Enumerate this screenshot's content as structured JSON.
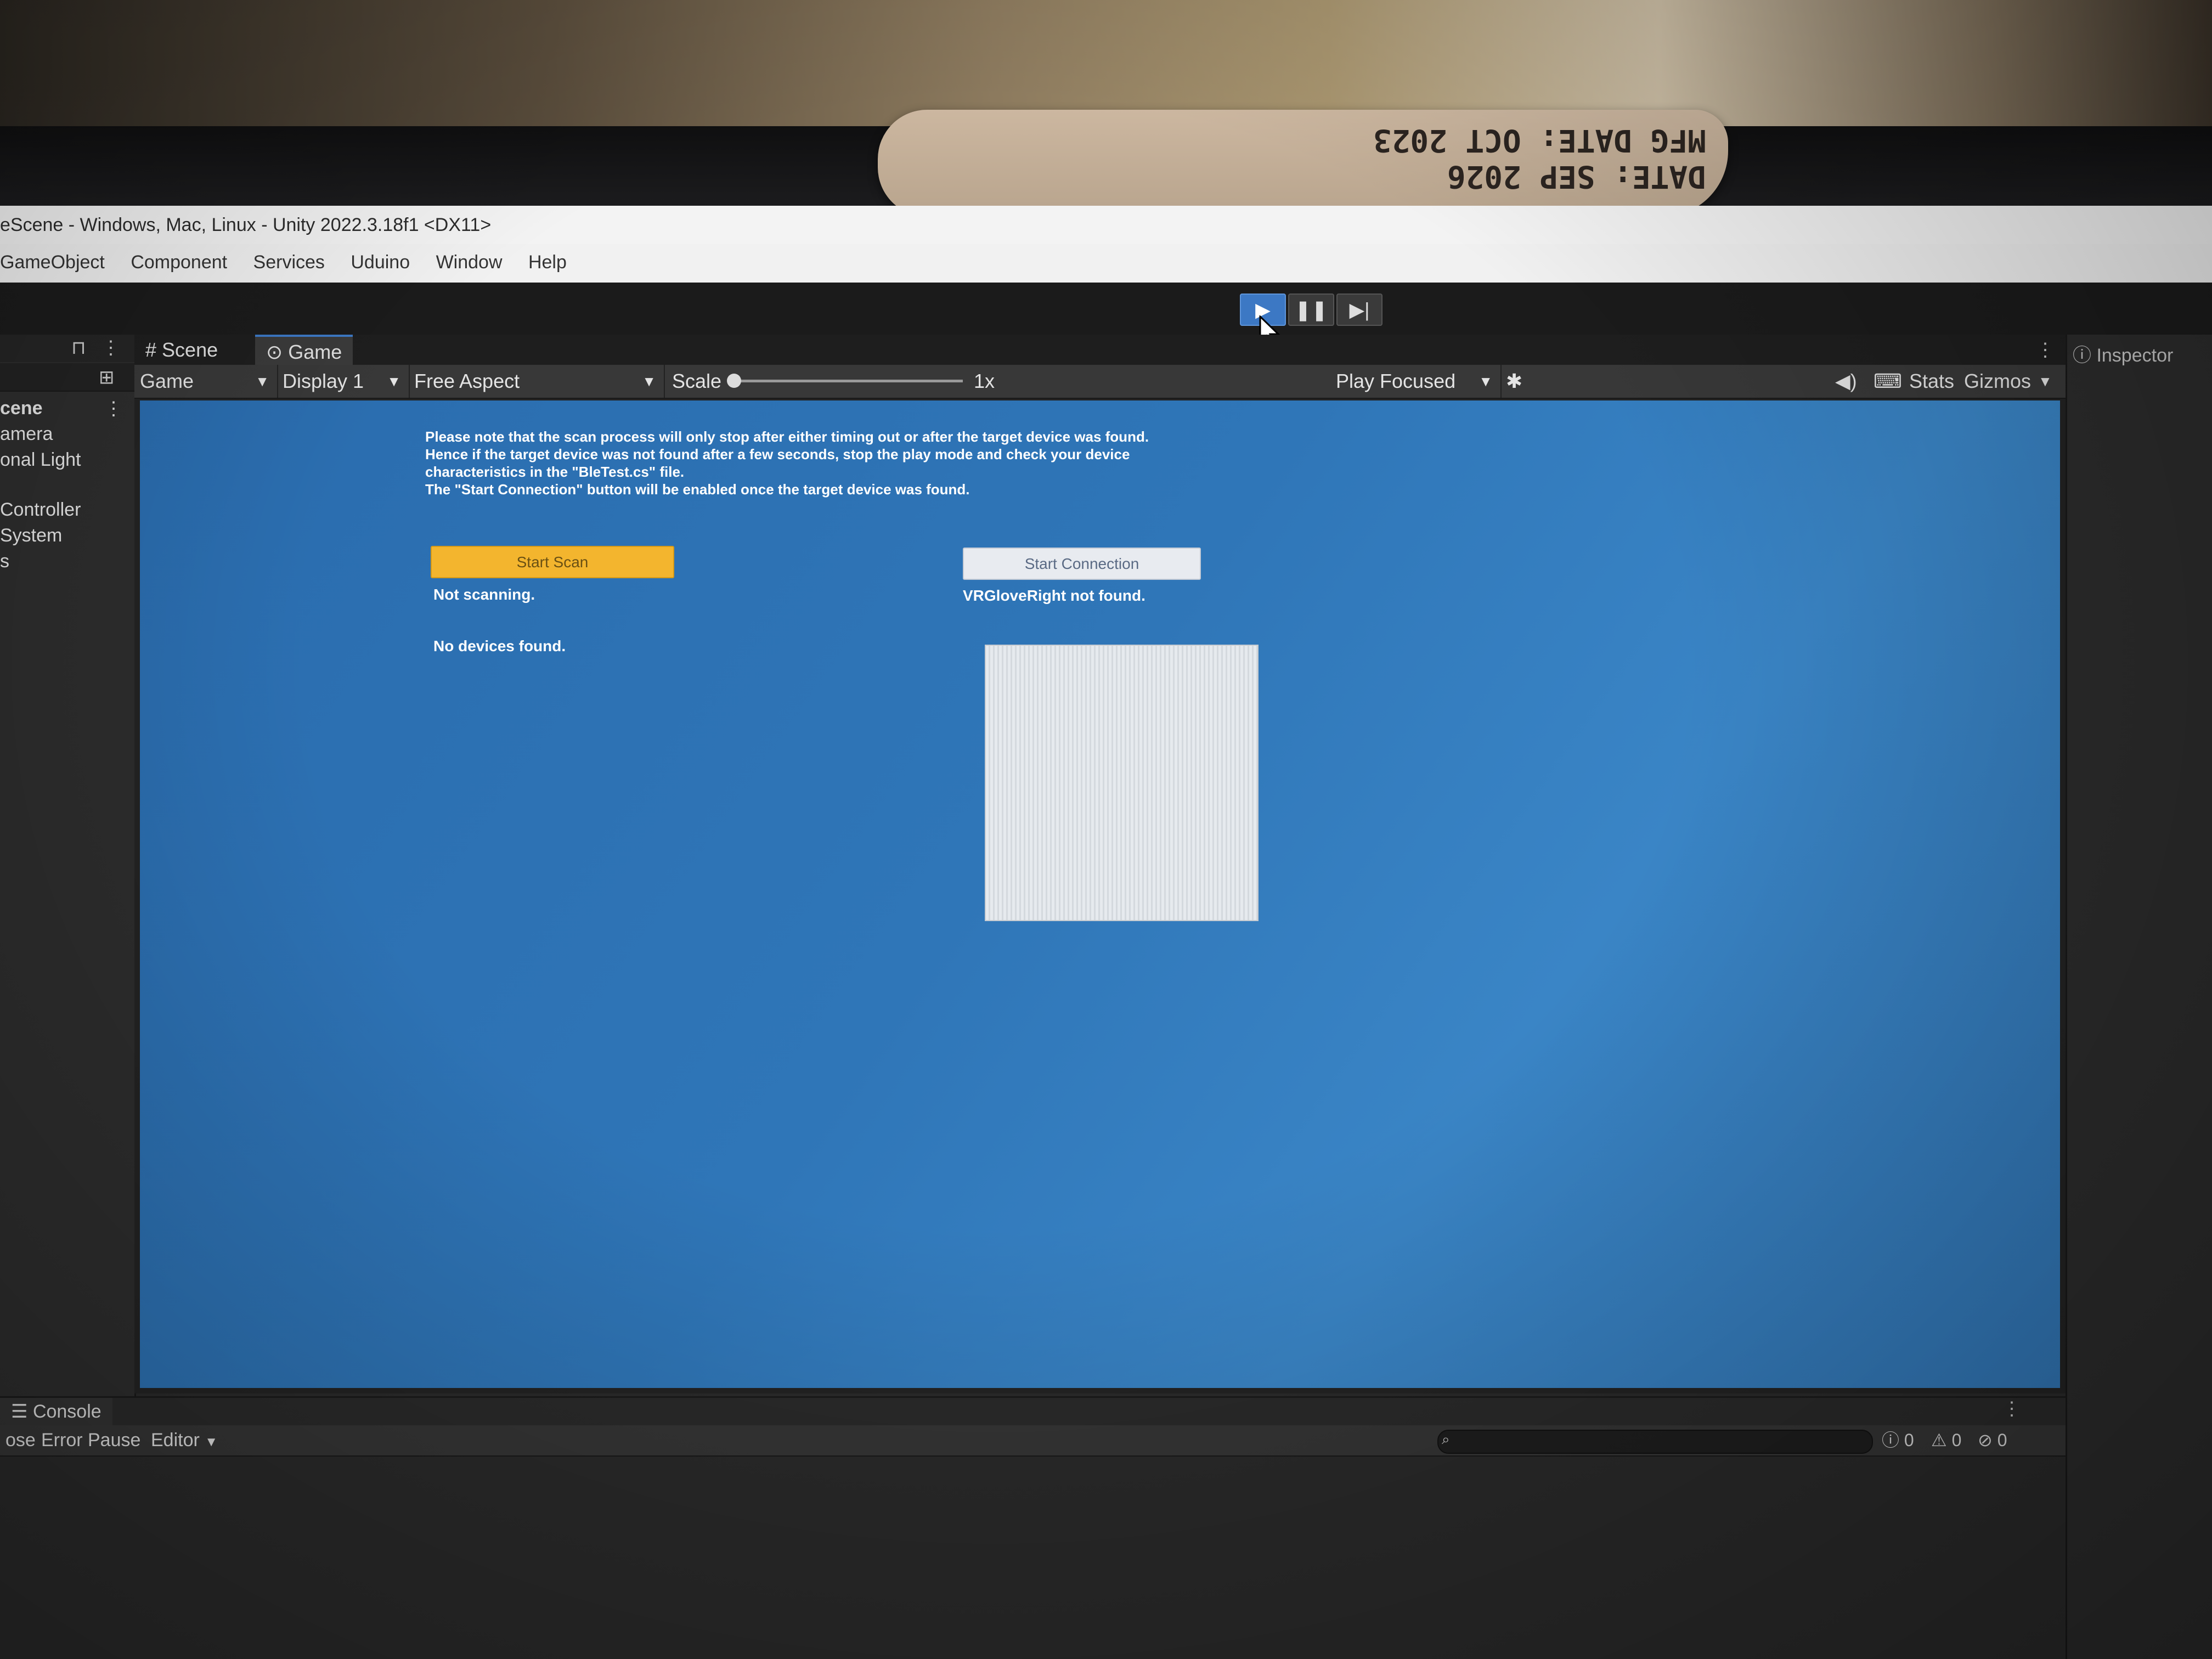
{
  "tape_label": {
    "line1": "MFG DATE: OCT 2023",
    "line2": "DATE: SEP 2026"
  },
  "title_bar": {
    "text": "eScene - Windows, Mac, Linux - Unity 2022.3.18f1 <DX11>"
  },
  "menu": {
    "items": [
      {
        "label": "GameObject"
      },
      {
        "label": "Component"
      },
      {
        "label": "Services"
      },
      {
        "label": "Uduino"
      },
      {
        "label": "Window"
      },
      {
        "label": "Help"
      }
    ]
  },
  "toolbar": {
    "play_icon": "▶",
    "pause_icon": "❚❚",
    "step_icon": "▶|"
  },
  "hierarchy": {
    "items": [
      {
        "label": "cene"
      },
      {
        "label": "amera"
      },
      {
        "label": "onal Light"
      },
      {
        "label": "Controller"
      },
      {
        "label": "System"
      },
      {
        "label": "s"
      }
    ]
  },
  "game_view": {
    "tabs": [
      {
        "label": "Scene",
        "icon": "#"
      },
      {
        "label": "Game",
        "icon": "⊙"
      }
    ],
    "toolbar": {
      "view_type": "Game",
      "display": "Display 1",
      "aspect": "Free Aspect",
      "scale_label": "Scale",
      "scale_value": "1x",
      "play_mode": "Play Focused",
      "stats": "Stats",
      "gizmos": "Gizmos"
    },
    "content": {
      "notice_lines": [
        "Please note that the scan process will only stop after either timing out or after the target device was found.",
        "Hence if the target device was not found after a few seconds, stop the play mode and check your device",
        "characteristics in the \"BleTest.cs\" file.",
        "The \"Start Connection\" button will be enabled once the target device was found."
      ],
      "start_scan_label": "Start Scan",
      "start_connection_label": "Start Connection",
      "scan_status": "Not scanning.",
      "device_status": "VRGloveRight not found.",
      "devices_status": "No devices found."
    }
  },
  "inspector": {
    "label": "Inspector"
  },
  "console": {
    "tab_label": "Console",
    "clear_label": "ose",
    "error_pause_label": "Error Pause",
    "editor_label": "Editor",
    "log_count": "0",
    "warning_count": "0",
    "error_count": "0"
  }
}
